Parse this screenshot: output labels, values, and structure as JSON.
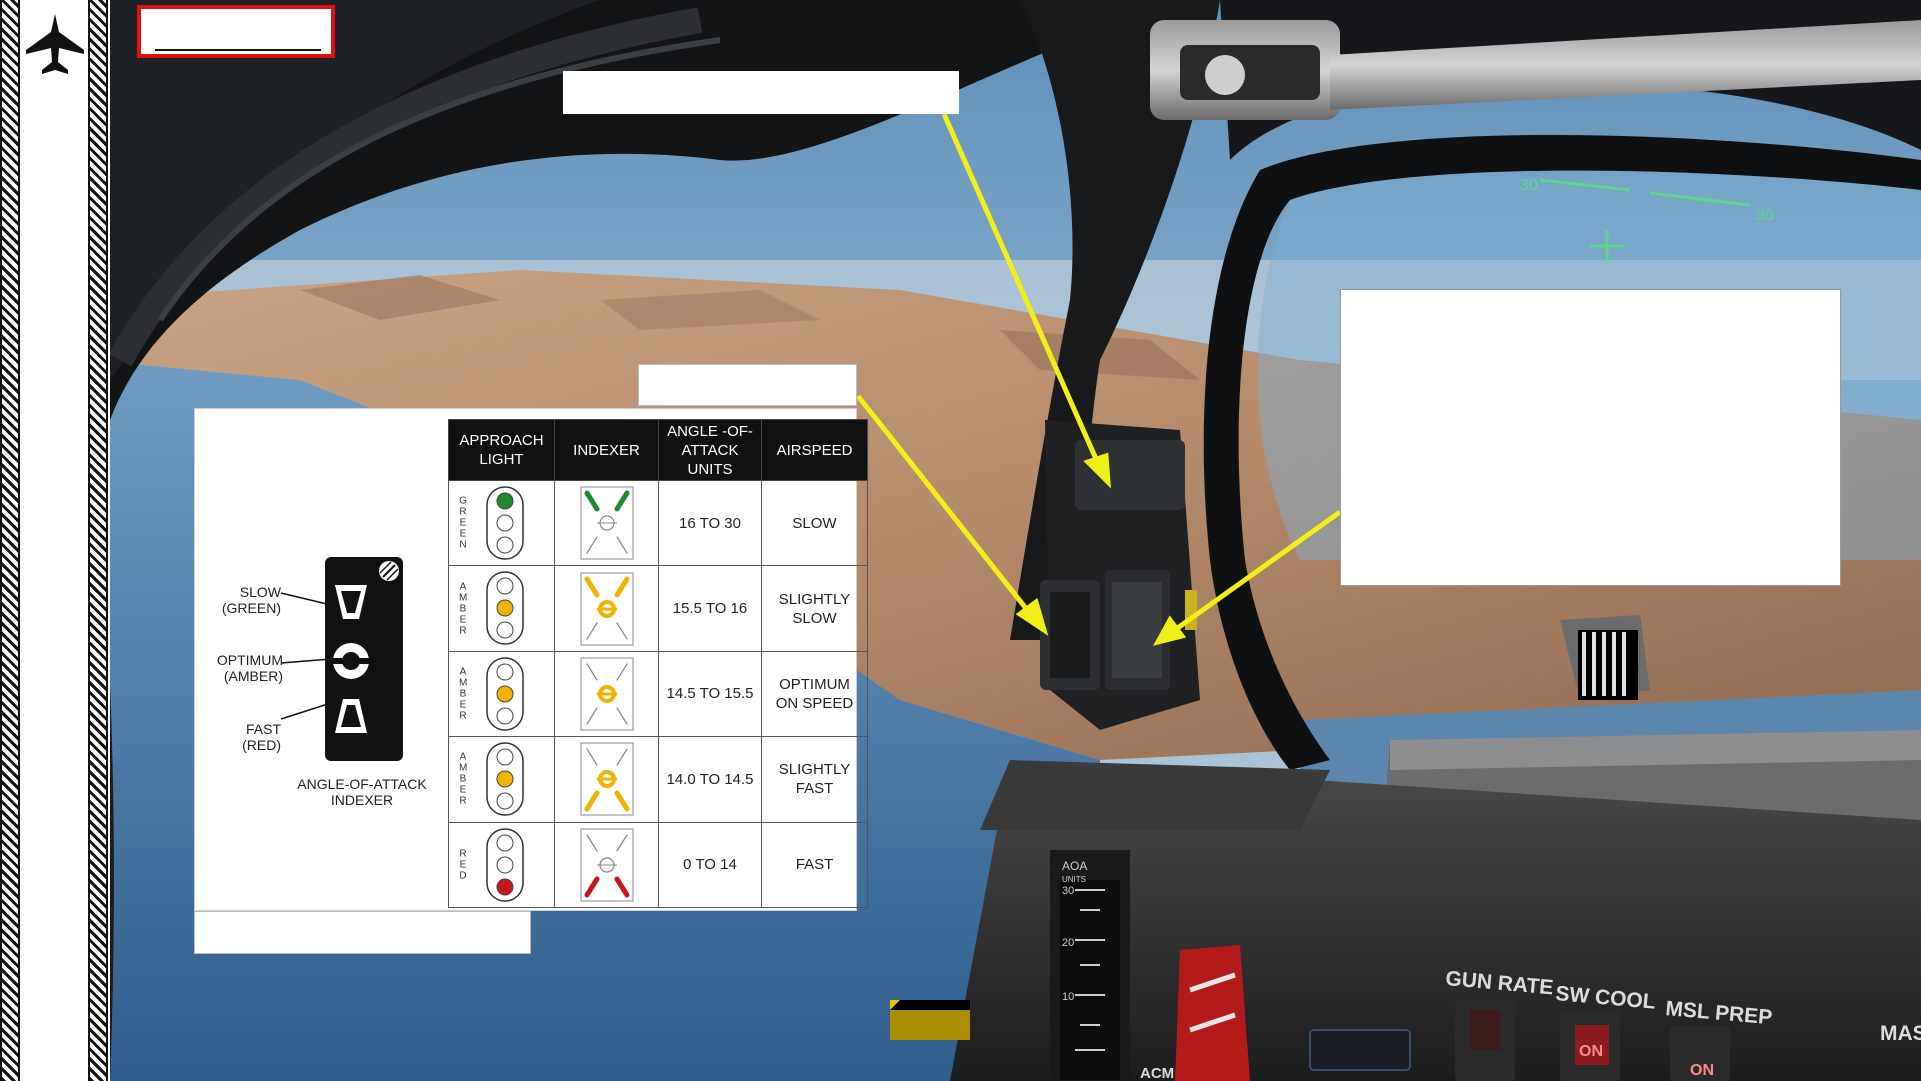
{
  "scene": {
    "hud_text": [
      "30",
      "30"
    ],
    "panel_labels": {
      "aoa": "AOA",
      "aoa_units": "UNITS",
      "gun_rate": "GUN RATE",
      "sw_cool": "SW COOL",
      "msl_prep": "MSL PREP",
      "master_arm": "MAS\nARM",
      "on_1": "ON",
      "on_2": "ON",
      "acm": "ACM",
      "scale": [
        "30",
        "20",
        "10"
      ]
    }
  },
  "indexer_diagram": {
    "slow_label": "SLOW\n(GREEN)",
    "optimum_label": "OPTIMUM\n(AMBER)",
    "fast_label": "FAST\n(RED)",
    "caption": "ANGLE-OF-ATTACK\nINDEXER"
  },
  "aoa_table": {
    "headers": [
      "APPROACH LIGHT",
      "INDEXER",
      "ANGLE -OF-ATTACK UNITS",
      "AIRSPEED"
    ],
    "rows": [
      {
        "light_color": "GREEN",
        "units": "16 TO 30",
        "airspeed": "SLOW"
      },
      {
        "light_color": "AMBER",
        "units": "15.5 TO 16",
        "airspeed": "SLIGHTLY SLOW"
      },
      {
        "light_color": "AMBER",
        "units": "14.5 TO 15.5",
        "airspeed": "OPTIMUM ON SPEED"
      },
      {
        "light_color": "AMBER",
        "units": "14.0 TO 14.5",
        "airspeed": "SLIGHTLY FAST"
      },
      {
        "light_color": "RED",
        "units": "0 TO 14",
        "airspeed": "FAST"
      }
    ]
  },
  "colors": {
    "callout_arrow": "#f2ee18",
    "title_border": "#e01010",
    "green_light": "#1f8a2e",
    "amber_light": "#f0b400",
    "red_light": "#c8161d"
  }
}
